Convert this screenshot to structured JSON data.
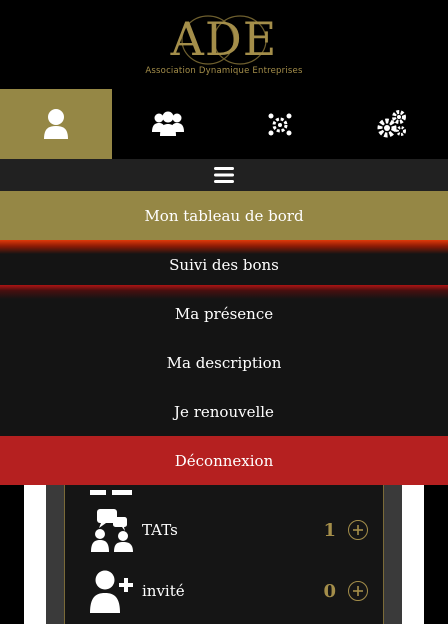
{
  "logo": {
    "letters": "ADE",
    "tagline": "Association Dynamique Entreprises"
  },
  "tabs": [
    {
      "icon": "user-icon",
      "active": true
    },
    {
      "icon": "users-group-icon",
      "active": false
    },
    {
      "icon": "network-gear-icon",
      "active": false
    },
    {
      "icon": "gears-icon",
      "active": false
    }
  ],
  "menu": {
    "toggle_icon": "hamburger-icon",
    "items": [
      {
        "label": "Mon tableau de bord",
        "state": "active"
      },
      {
        "label": "Suivi des bons",
        "state": "normal"
      },
      {
        "label": "Ma présence",
        "state": "normal"
      },
      {
        "label": "Ma description",
        "state": "normal"
      },
      {
        "label": "Je renouvelle",
        "state": "normal"
      },
      {
        "label": "Déconnexion",
        "state": "danger"
      }
    ]
  },
  "stats": [
    {
      "icon": "chat-group-icon",
      "label": "TATs",
      "count": "1",
      "action": "add-icon"
    },
    {
      "icon": "user-plus-icon",
      "label": "invité",
      "count": "0",
      "action": "add-icon"
    }
  ],
  "colors": {
    "gold": "#958745",
    "gold_text": "#a48e4a",
    "danger": "#b52020",
    "menu_bg": "#141414",
    "bar_bg": "#212121"
  }
}
